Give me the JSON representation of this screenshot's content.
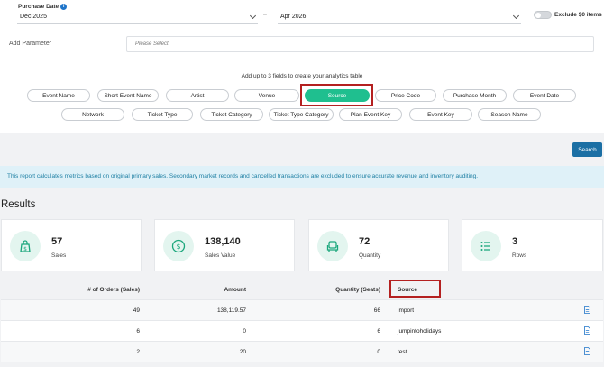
{
  "filters": {
    "purchase_date_label": "Purchase Date",
    "date_from": "Dec 2025",
    "date_to": "Apr 2026",
    "exclude_label": "Exclude $0 items",
    "add_parameter_label": "Add Parameter",
    "param_placeholder": "Please Select",
    "hint": "Add up to 3 fields to create your analytics table",
    "fields_row1": [
      "Event Name",
      "Short Event Name",
      "Artist",
      "Venue",
      "Source",
      "Price Code",
      "Purchase Month",
      "Event Date"
    ],
    "fields_row2": [
      "Network",
      "Ticket Type",
      "Ticket Category",
      "Ticket Type Category",
      "Plan Event Key",
      "Event Key",
      "Season Name"
    ],
    "selected_field": "Source"
  },
  "search_label": "Search",
  "notice": "This report calculates metrics based on original primary sales. Secondary market records and cancelled transactions are excluded to ensure accurate revenue and inventory auditing.",
  "results": {
    "title": "Results",
    "cards": [
      {
        "value": "57",
        "label": "Sales",
        "icon": "bag-dollar-icon"
      },
      {
        "value": "138,140",
        "label": "Sales Value",
        "icon": "dollar-circle-icon"
      },
      {
        "value": "72",
        "label": "Quantity",
        "icon": "seat-icon"
      },
      {
        "value": "3",
        "label": "Rows",
        "icon": "list-icon"
      }
    ]
  },
  "table": {
    "headers": [
      "# of Orders (Sales)",
      "Amount",
      "Quantity (Seats)",
      "Source"
    ],
    "rows": [
      [
        "49",
        "138,119.57",
        "66",
        "import"
      ],
      [
        "6",
        "0",
        "6",
        "jumpintoholidays"
      ],
      [
        "2",
        "20",
        "0",
        "test"
      ]
    ]
  },
  "colors": {
    "accent": "#1fbf8f",
    "primary": "#1b6fa4",
    "highlight": "#b42020",
    "notice_bg": "#dff1f8"
  }
}
